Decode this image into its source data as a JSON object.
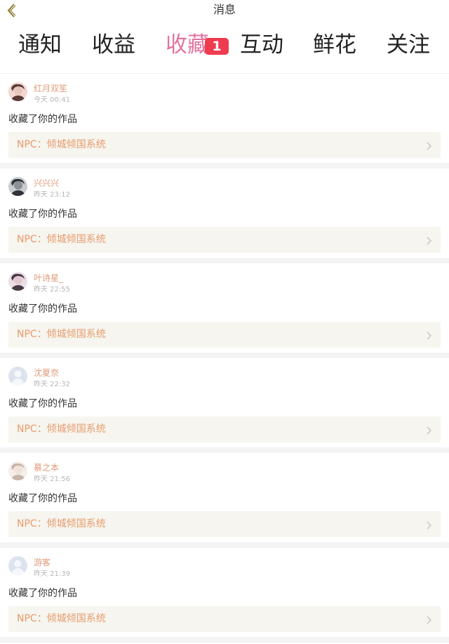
{
  "header": {
    "title": "消息",
    "back_icon": "chevron-left-icon"
  },
  "tabs": [
    {
      "label": "通知",
      "active": false
    },
    {
      "label": "收益",
      "active": false
    },
    {
      "label": "收藏",
      "active": true,
      "badge": "1"
    },
    {
      "label": "互动",
      "active": false
    },
    {
      "label": "鲜花",
      "active": false
    },
    {
      "label": "关注",
      "active": false
    }
  ],
  "colors": {
    "accent": "#e2739e",
    "badge": "#ef3b4f",
    "username": "#e19a7a",
    "work_title": "#e79c6d",
    "work_bg": "#f6f5ef"
  },
  "notifications": [
    {
      "user": "红月双笙",
      "time": "今天 00:41",
      "action": "收藏了你的作品",
      "work": "NPC：倾城倾国系统",
      "avatar": "photo-avatar"
    },
    {
      "user": "兴兴兴",
      "time": "昨天 23:12",
      "action": "收藏了你的作品",
      "work": "NPC：倾城倾国系统",
      "avatar": "photo-avatar"
    },
    {
      "user": "叶诗星_",
      "time": "昨天 22:55",
      "action": "收藏了你的作品",
      "work": "NPC：倾城倾国系统",
      "avatar": "photo-avatar"
    },
    {
      "user": "沈夏奈",
      "time": "昨天 22:32",
      "action": "收藏了你的作品",
      "work": "NPC：倾城倾国系统",
      "avatar": "default-avatar"
    },
    {
      "user": "慕之本",
      "time": "昨天 21:56",
      "action": "收藏了你的作品",
      "work": "NPC：倾城倾国系统",
      "avatar": "photo-avatar"
    },
    {
      "user": "游客",
      "time": "昨天 21:39",
      "action": "收藏了你的作品",
      "work": "NPC：倾城倾国系统",
      "avatar": "default-avatar"
    }
  ]
}
